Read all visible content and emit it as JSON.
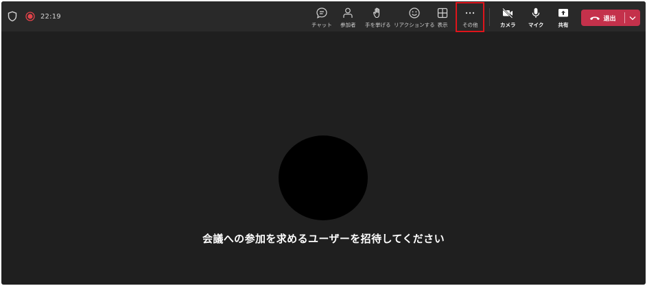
{
  "status": {
    "time": "22:19",
    "icons": [
      "shield-icon",
      "recording-icon"
    ]
  },
  "toolbar": {
    "chat": {
      "label": "チャット",
      "icon": "chat-icon"
    },
    "participants": {
      "label": "参加者",
      "icon": "person-icon"
    },
    "raise_hand": {
      "label": "手を挙げる",
      "icon": "hand-icon"
    },
    "reactions": {
      "label": "リアクションする",
      "icon": "smile-icon"
    },
    "view": {
      "label": "表示",
      "icon": "grid-icon"
    },
    "more": {
      "label": "その他",
      "icon": "ellipsis-icon",
      "highlighted": true
    },
    "camera": {
      "label": "カメラ",
      "icon": "camera-off-icon"
    },
    "mic": {
      "label": "マイク",
      "icon": "microphone-icon"
    },
    "share": {
      "label": "共有",
      "icon": "share-icon"
    },
    "leave": {
      "label": "退出",
      "icon": "phone-hangup-icon",
      "color": "#c4314b"
    }
  },
  "main": {
    "invite_text": "会議への参加を求めるユーザーを招待してください"
  },
  "colors": {
    "background": "#1f1f1f",
    "topbar": "#292929",
    "highlight": "#e0141b",
    "record": "#e3434a"
  }
}
